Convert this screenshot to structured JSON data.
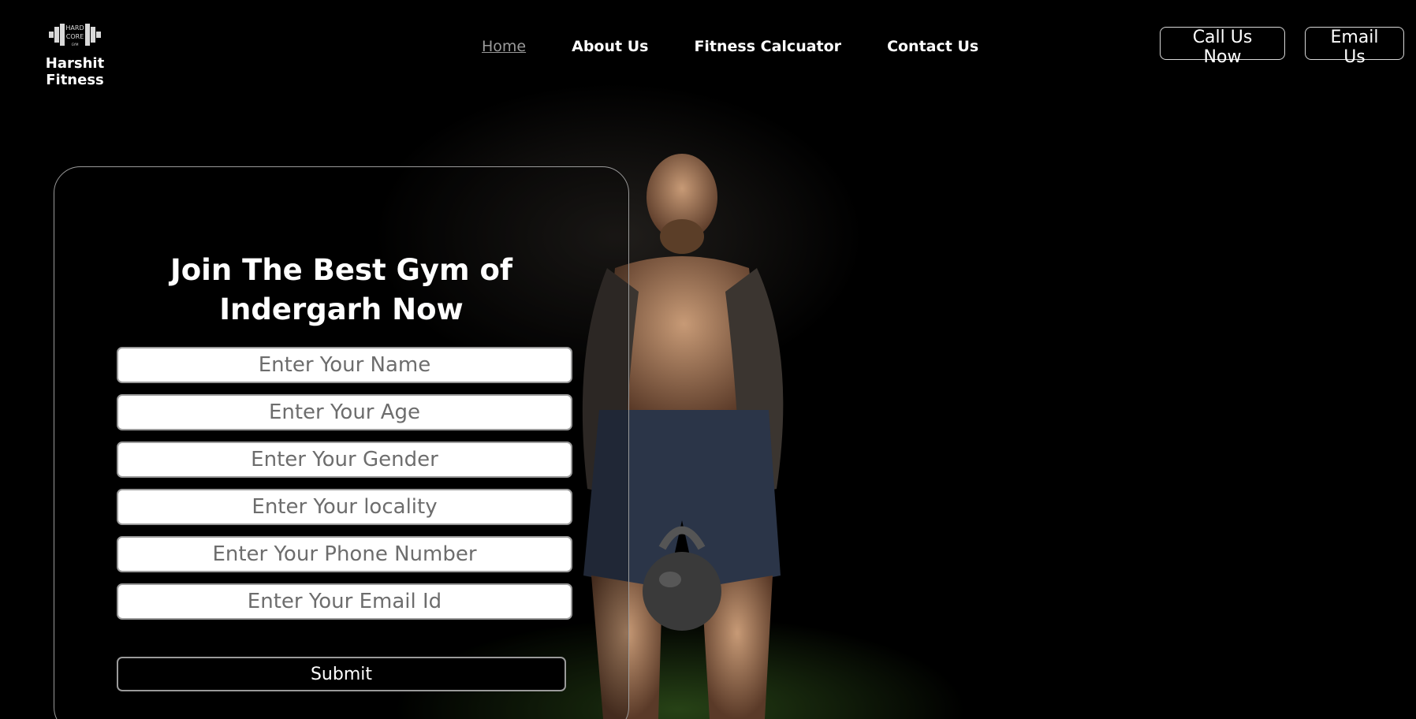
{
  "brand": {
    "name": "Harshit Fitness",
    "logo_icon": "dumbbell-icon",
    "logo_text_line1": "HARD",
    "logo_text_line2": "CORE",
    "logo_text_line3": "GYM"
  },
  "nav": {
    "items": [
      {
        "label": "Home",
        "active": true
      },
      {
        "label": "About Us",
        "active": false
      },
      {
        "label": "Fitness Calcuator",
        "active": false
      },
      {
        "label": "Contact Us",
        "active": false
      }
    ]
  },
  "header_buttons": {
    "call": "Call Us Now",
    "email": "Email Us"
  },
  "form": {
    "title": "Join The Best Gym of Indergarh Now",
    "fields": [
      {
        "placeholder": "Enter Your Name",
        "value": ""
      },
      {
        "placeholder": "Enter Your Age",
        "value": ""
      },
      {
        "placeholder": "Enter Your Gender",
        "value": ""
      },
      {
        "placeholder": "Enter Your locality",
        "value": ""
      },
      {
        "placeholder": "Enter Your Phone Number",
        "value": ""
      },
      {
        "placeholder": "Enter Your Email Id",
        "value": ""
      }
    ],
    "submit_label": "Submit"
  },
  "colors": {
    "background": "#000000",
    "text": "#ffffff",
    "border": "#9a9a9a",
    "nav_active": "#9a9a9a",
    "turf": "#3f6a24"
  }
}
